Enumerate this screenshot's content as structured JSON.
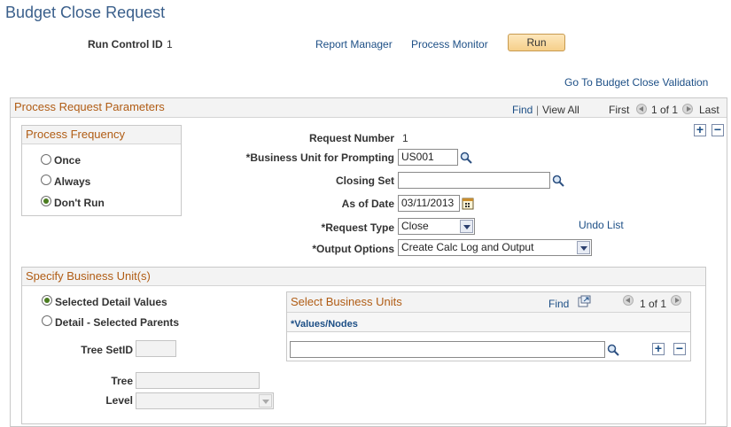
{
  "page_title": "Budget Close Request",
  "header": {
    "run_control_label": "Run Control ID",
    "run_control_value": "1",
    "report_manager": "Report Manager",
    "process_monitor": "Process Monitor",
    "run_button": "Run",
    "goto_link": "Go To Budget Close Validation"
  },
  "params": {
    "title": "Process Request Parameters",
    "nav": {
      "find": "Find",
      "sep": "|",
      "view_all": "View All",
      "first": "First",
      "count": "1 of 1",
      "last": "Last"
    },
    "frequency": {
      "title": "Process Frequency",
      "options": [
        "Once",
        "Always",
        "Don't Run"
      ],
      "selected_index": 2
    },
    "request_number_label": "Request Number",
    "request_number_value": "1",
    "business_unit_label": "*Business Unit for Prompting",
    "business_unit_value": "US001",
    "closing_set_label": "Closing Set",
    "closing_set_value": "",
    "as_of_date_label": "As of Date",
    "as_of_date_value": "03/11/2013",
    "request_type_label": "*Request Type",
    "request_type_value": "Close",
    "undo_list": "Undo List",
    "output_options_label": "*Output Options",
    "output_options_value": "Create Calc Log and Output"
  },
  "bu_section": {
    "title": "Specify Business Unit(s)",
    "options": [
      "Selected Detail Values",
      "Detail - Selected Parents"
    ],
    "selected_index": 0,
    "tree_setid_label": "Tree SetID",
    "tree_setid_value": "",
    "tree_label": "Tree",
    "tree_value": "",
    "level_label": "Level",
    "level_value": "",
    "grid": {
      "title": "Select Business Units",
      "find": "Find",
      "count": "1 of 1",
      "column": "*Values/Nodes",
      "row_value": ""
    }
  },
  "colors": {
    "title": "#3a5f8b",
    "link": "#1d4f86",
    "group_title": "#b05c14",
    "run_button": "#f6cf8a"
  }
}
